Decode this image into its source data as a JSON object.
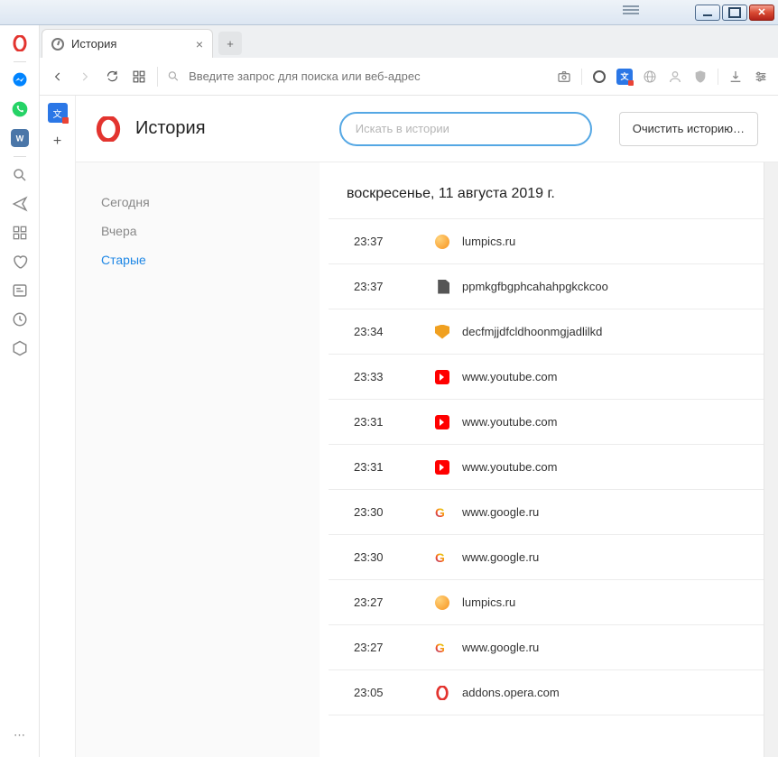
{
  "window": {
    "title": "История"
  },
  "tab": {
    "label": "История"
  },
  "addressbar": {
    "placeholder": "Введите запрос для поиска или веб-адрес"
  },
  "history": {
    "title": "История",
    "search_placeholder": "Искать в истории",
    "clear_label": "Очистить историю…",
    "filters": {
      "today": "Сегодня",
      "yesterday": "Вчера",
      "older": "Старые"
    },
    "date_heading": "воскресенье, 11 августа 2019 г.",
    "entries": [
      {
        "time": "23:37",
        "url": "lumpics.ru",
        "icon": "orange"
      },
      {
        "time": "23:37",
        "url": "ppmkgfbgphcahahpgkckcoo",
        "icon": "file"
      },
      {
        "time": "23:34",
        "url": "decfmjjdfcldhoonmgjadlilkd",
        "icon": "shield"
      },
      {
        "time": "23:33",
        "url": "www.youtube.com",
        "icon": "youtube"
      },
      {
        "time": "23:31",
        "url": "www.youtube.com",
        "icon": "youtube"
      },
      {
        "time": "23:31",
        "url": "www.youtube.com",
        "icon": "youtube"
      },
      {
        "time": "23:30",
        "url": "www.google.ru",
        "icon": "google"
      },
      {
        "time": "23:30",
        "url": "www.google.ru",
        "icon": "google"
      },
      {
        "time": "23:27",
        "url": "lumpics.ru",
        "icon": "orange"
      },
      {
        "time": "23:27",
        "url": "www.google.ru",
        "icon": "google"
      },
      {
        "time": "23:05",
        "url": "addons.opera.com",
        "icon": "opera"
      }
    ]
  }
}
